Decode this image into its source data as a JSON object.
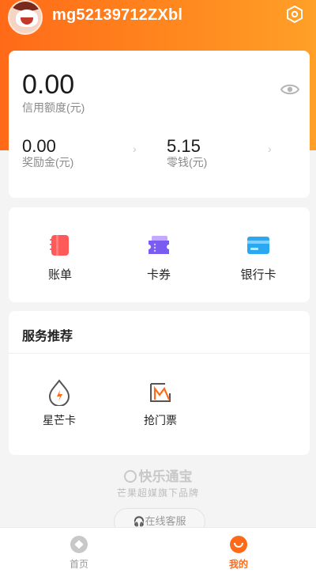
{
  "header": {
    "username": "mg52139712ZXbl"
  },
  "balance": {
    "credit_amount": "0.00",
    "credit_label": "信用额度(元)",
    "bonus_amount": "0.00",
    "bonus_label": "奖励金(元)",
    "change_amount": "5.15",
    "change_label": "零钱(元)",
    "chevron": "›"
  },
  "tools": [
    {
      "label": "账单",
      "icon": "bill-icon",
      "color": "#ff5a5a"
    },
    {
      "label": "卡券",
      "icon": "coupon-icon",
      "color": "#7b5cf0"
    },
    {
      "label": "银行卡",
      "icon": "bank-card-icon",
      "color": "#2aa8f2"
    }
  ],
  "services": {
    "title": "服务推荐",
    "items": [
      {
        "label": "星芒卡",
        "icon": "flame-card-icon"
      },
      {
        "label": "抢门票",
        "icon": "ticket-icon"
      }
    ]
  },
  "footer": {
    "brand": "快乐通宝",
    "brand_sub": "芒果超媒旗下品牌",
    "service_button": "在线客服"
  },
  "tabbar": {
    "tabs": [
      {
        "label": "首页",
        "active": false
      },
      {
        "label": "我的",
        "active": true
      }
    ],
    "active_color": "#ff6a18",
    "inactive_color": "#9a9a9a"
  },
  "colors": {
    "accent": "#ff6a18"
  }
}
